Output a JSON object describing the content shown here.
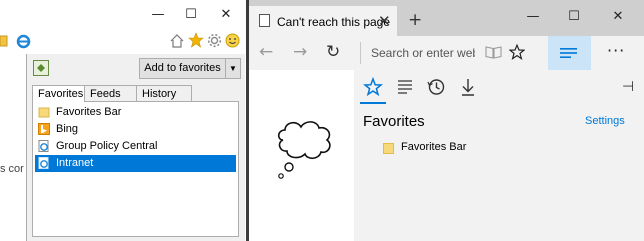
{
  "ie": {
    "caption": {
      "minimize": "—",
      "maximize": "☐",
      "close": "✕"
    },
    "truncated_text": "s cor",
    "favorites_center": {
      "add_button": "Add to favorites",
      "dropdown_arrow": "▼",
      "tabs": [
        {
          "label": "Favorites",
          "selected": true
        },
        {
          "label": "Feeds",
          "selected": false
        },
        {
          "label": "History",
          "selected": false
        }
      ],
      "items": [
        {
          "label": "Favorites Bar",
          "icon": "folder-icon",
          "selected": false
        },
        {
          "label": "Bing",
          "icon": "bing-icon",
          "selected": false
        },
        {
          "label": "Group Policy Central",
          "icon": "ie-page-icon",
          "selected": false
        },
        {
          "label": "Intranet",
          "icon": "ie-page-icon",
          "selected": true
        }
      ]
    }
  },
  "edge": {
    "tab_title": "Can't reach this page",
    "tab_close": "✕",
    "new_tab": "+",
    "caption": {
      "minimize": "—",
      "maximize": "☐",
      "close": "✕"
    },
    "nav": {
      "back": "←",
      "forward": "→",
      "refresh": "↻"
    },
    "search_placeholder": "Search or enter web ad",
    "more": "···",
    "hub": {
      "title": "Favorites",
      "settings_link": "Settings",
      "pin": "⊣",
      "items": [
        {
          "label": "Favorites Bar",
          "icon": "folder-icon"
        }
      ]
    }
  },
  "colors": {
    "accent": "#0078d7",
    "selection": "#0078d7",
    "hub_highlight": "#cce4f7",
    "divider": "#3c3c3c",
    "edge_tabbar": "#cfcfcf",
    "edge_chrome": "#f2f2f2"
  }
}
